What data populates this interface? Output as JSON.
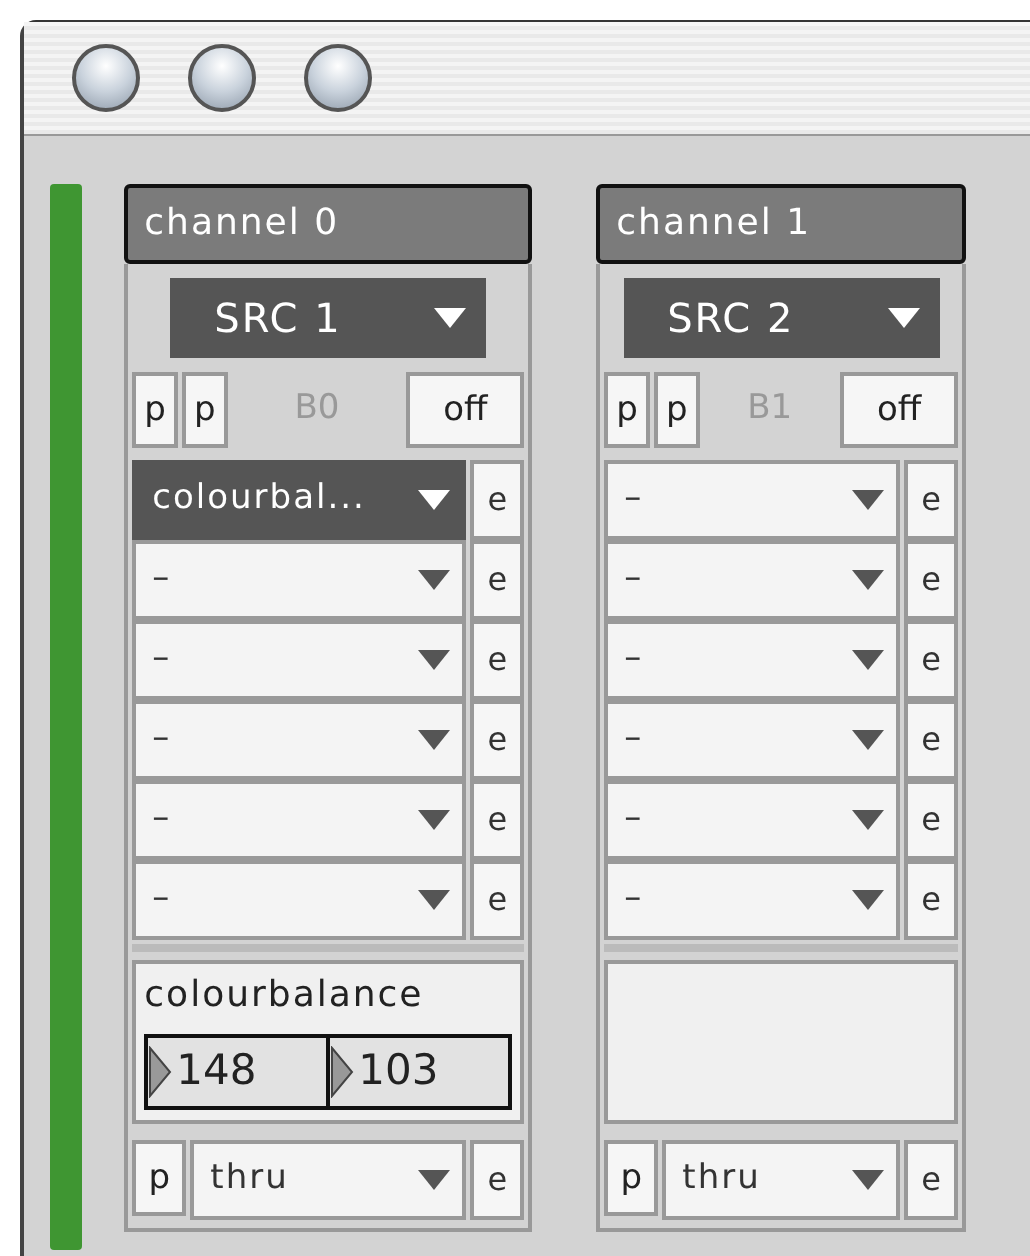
{
  "channels": [
    {
      "title": "channel 0",
      "source": "SRC 1",
      "p_buttons": [
        "p",
        "p"
      ],
      "bank": "B0",
      "toggle": "off",
      "effects": [
        {
          "label": "colourbal...",
          "selected": true,
          "edit": "e"
        },
        {
          "label": "–",
          "selected": false,
          "edit": "e"
        },
        {
          "label": "–",
          "selected": false,
          "edit": "e"
        },
        {
          "label": "–",
          "selected": false,
          "edit": "e"
        },
        {
          "label": "–",
          "selected": false,
          "edit": "e"
        },
        {
          "label": "–",
          "selected": false,
          "edit": "e"
        }
      ],
      "params": {
        "name": "colourbalance",
        "values": [
          "148",
          "103"
        ]
      },
      "output": {
        "p": "p",
        "label": "thru",
        "edit": "e"
      }
    },
    {
      "title": "channel 1",
      "source": "SRC 2",
      "p_buttons": [
        "p",
        "p"
      ],
      "bank": "B1",
      "toggle": "off",
      "effects": [
        {
          "label": "–",
          "selected": false,
          "edit": "e"
        },
        {
          "label": "–",
          "selected": false,
          "edit": "e"
        },
        {
          "label": "–",
          "selected": false,
          "edit": "e"
        },
        {
          "label": "–",
          "selected": false,
          "edit": "e"
        },
        {
          "label": "–",
          "selected": false,
          "edit": "e"
        },
        {
          "label": "–",
          "selected": false,
          "edit": "e"
        }
      ],
      "output": {
        "p": "p",
        "label": "thru",
        "edit": "e"
      }
    }
  ]
}
